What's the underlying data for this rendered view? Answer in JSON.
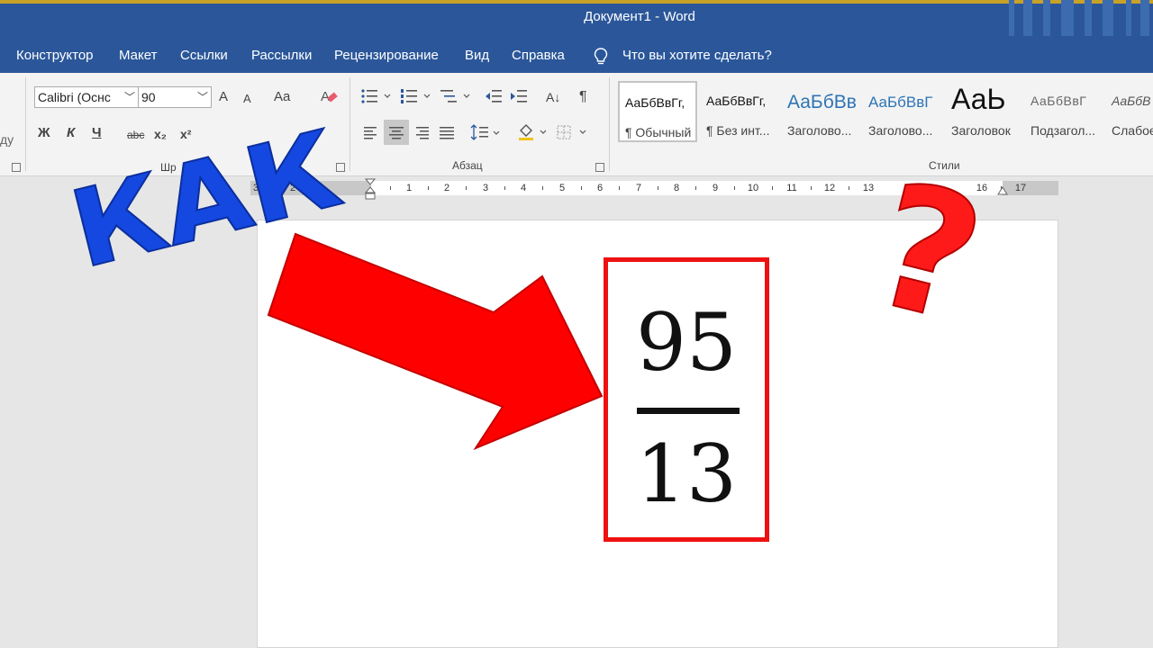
{
  "window": {
    "title": "Документ1  -  Word"
  },
  "menu": {
    "tabs": [
      "Конструктор",
      "Макет",
      "Ссылки",
      "Рассылки",
      "Рецензирование",
      "Вид",
      "Справка"
    ],
    "tell_me": "Что вы хотите сделать?"
  },
  "ribbon": {
    "font": {
      "name": "Calibri (Оснс",
      "size": "90",
      "grow_label": "A",
      "shrink_label": "A",
      "case_label": "Aa",
      "bold_label": "Ж",
      "italic_label": "К",
      "underline_label": "Ч",
      "strike_label": "abc",
      "subscript_label": "x₂",
      "superscript_label": "x²",
      "group_label": "Шр"
    },
    "paragraph": {
      "group_label": "Абзац",
      "sort_label": "A↓",
      "pilcrow_label": "¶"
    },
    "styles": {
      "group_label": "Стили",
      "items": [
        {
          "sample": "АаБбВвГг,",
          "name": "¶ Обычный"
        },
        {
          "sample": "АаБбВвГг,",
          "name": "¶ Без инт..."
        },
        {
          "sample": "АаБбВв",
          "name": "Заголово..."
        },
        {
          "sample": "АаБбВвГ",
          "name": "Заголово..."
        },
        {
          "sample": "АаЬ",
          "name": "Заголовок"
        },
        {
          "sample": "АаБбВвГ",
          "name": "Подзагол..."
        },
        {
          "sample": "АаБбВ",
          "name": "Слабое..."
        }
      ]
    },
    "left_cut_label": "ду"
  },
  "ruler": {
    "left_numbers": [
      "3",
      "2"
    ],
    "numbers": [
      "1",
      "2",
      "3",
      "4",
      "5",
      "6",
      "7",
      "8",
      "9",
      "10",
      "11",
      "12",
      "13",
      "16",
      "17"
    ]
  },
  "document": {
    "numerator": "95",
    "denominator": "13"
  },
  "overlay": {
    "headline": "КАК",
    "question": "?"
  },
  "colors": {
    "word_blue": "#2b579a",
    "overlay_blue": "#1448e0",
    "overlay_red": "#ff0000"
  },
  "icons": {
    "bulb": "lightbulb-icon",
    "eraser": "clear-format-icon",
    "bullets": "bullet-list-icon",
    "numbering": "numbered-list-icon",
    "multilevel": "multilevel-list-icon"
  }
}
